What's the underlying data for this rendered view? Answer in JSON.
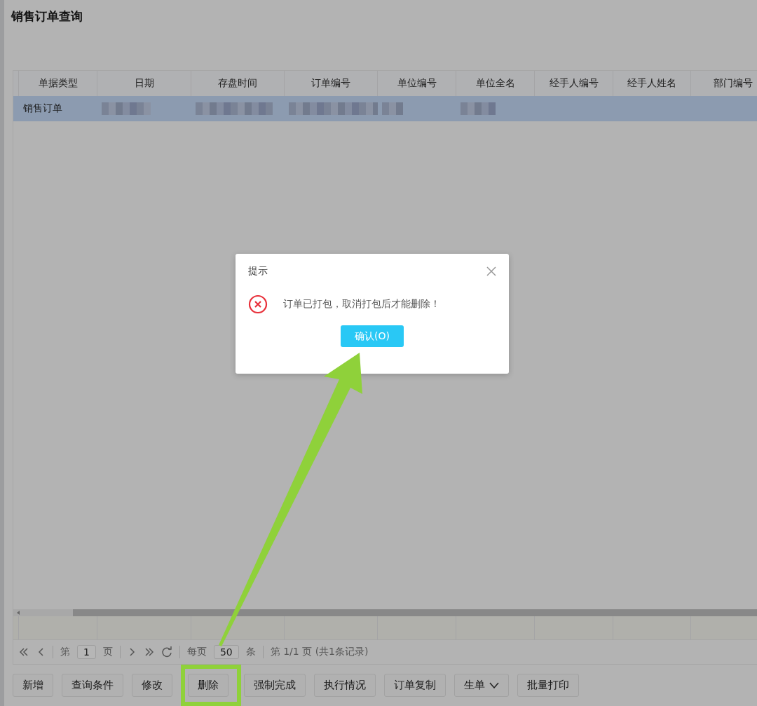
{
  "page": {
    "title": "销售订单查询"
  },
  "table": {
    "columns": [
      "单据类型",
      "日期",
      "存盘时间",
      "订单编号",
      "单位编号",
      "单位全名",
      "经手人编号",
      "经手人姓名",
      "部门编号"
    ],
    "rows": [
      {
        "selected": true,
        "cells": [
          {
            "kind": "text",
            "text": "销售订单"
          },
          {
            "kind": "blurred"
          },
          {
            "kind": "blurred"
          },
          {
            "kind": "blurred"
          },
          {
            "kind": "blurred"
          },
          {
            "kind": "blurred"
          },
          {
            "kind": "empty"
          },
          {
            "kind": "empty"
          },
          {
            "kind": "empty"
          }
        ]
      }
    ]
  },
  "pager": {
    "page_prefix": "第",
    "page": "1",
    "page_suffix": "页",
    "per_page_label": "每页",
    "per_page": "50",
    "per_page_unit": "条",
    "summary": "第 1/1 页 (共1条记录)"
  },
  "buttons": [
    {
      "label": "新增",
      "dropdown": false,
      "highlighted": false
    },
    {
      "label": "查询条件",
      "dropdown": false,
      "highlighted": false
    },
    {
      "label": "修改",
      "dropdown": false,
      "highlighted": false
    },
    {
      "label": "删除",
      "dropdown": false,
      "highlighted": true
    },
    {
      "label": "强制完成",
      "dropdown": false,
      "highlighted": false
    },
    {
      "label": "执行情况",
      "dropdown": false,
      "highlighted": false
    },
    {
      "label": "订单复制",
      "dropdown": false,
      "highlighted": false
    },
    {
      "label": "生单",
      "dropdown": true,
      "highlighted": false
    },
    {
      "label": "批量打印",
      "dropdown": false,
      "highlighted": false
    }
  ],
  "dialog": {
    "title": "提示",
    "message": "订单已打包，取消打包后才能删除！",
    "confirm": "确认(O)"
  }
}
